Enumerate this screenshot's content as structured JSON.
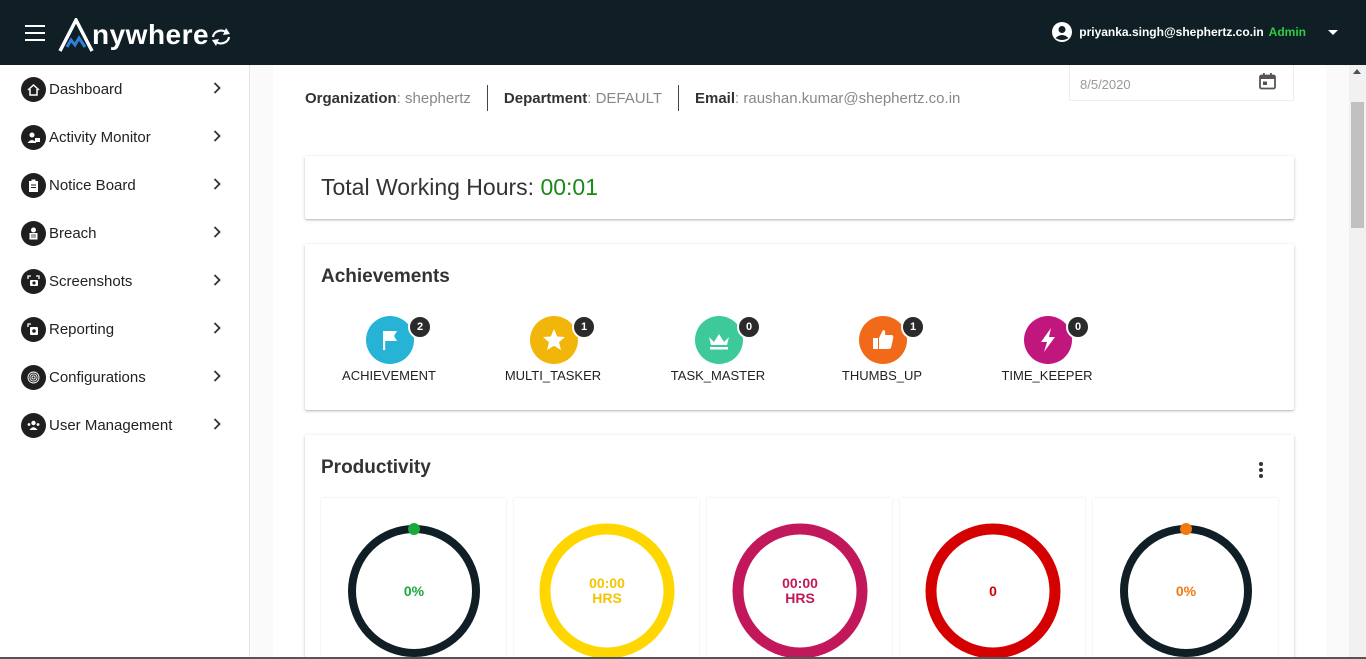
{
  "app": {
    "logo_text": "nywhere"
  },
  "user": {
    "email": "priyanka.singh@shephertz.co.in",
    "role": "Admin"
  },
  "sidebar": {
    "items": [
      {
        "label": "Dashboard",
        "icon": "home-icon"
      },
      {
        "label": "Activity Monitor",
        "icon": "person-monitor-icon"
      },
      {
        "label": "Notice Board",
        "icon": "clipboard-icon"
      },
      {
        "label": "Breach",
        "icon": "breach-icon"
      },
      {
        "label": "Screenshots",
        "icon": "screenshot-icon"
      },
      {
        "label": "Reporting",
        "icon": "report-icon"
      },
      {
        "label": "Configurations",
        "icon": "fingerprint-icon"
      },
      {
        "label": "User Management",
        "icon": "users-icon"
      }
    ]
  },
  "info": {
    "org_label": "Organization",
    "org_value": ": shephertz",
    "dept_label": "Department",
    "dept_value": ": DEFAULT",
    "email_label": "Email",
    "email_value": ": raushan.kumar@shephertz.co.in"
  },
  "date_picker": {
    "value": "8/5/2020"
  },
  "hours": {
    "label": "Total Working Hours: ",
    "value": "00:01"
  },
  "achievements": {
    "title": "Achievements",
    "badges": [
      {
        "label": "ACHIEVEMENT",
        "count": "2",
        "color": "#27b3d6",
        "icon": "flag-icon"
      },
      {
        "label": "MULTI_TASKER",
        "count": "1",
        "color": "#f2b50a",
        "icon": "star-icon"
      },
      {
        "label": "TASK_MASTER",
        "count": "0",
        "color": "#3dc99a",
        "icon": "crown-icon"
      },
      {
        "label": "THUMBS_UP",
        "count": "1",
        "color": "#f06a1a",
        "icon": "thumbs-up-icon"
      },
      {
        "label": "TIME_KEEPER",
        "count": "0",
        "color": "#c0167d",
        "icon": "lightning-icon"
      }
    ]
  },
  "productivity": {
    "title": "Productivity",
    "tiles": [
      {
        "line1": "0%",
        "line2": "",
        "ring_color": "#0f1f25",
        "text_color": "#1aaa3c",
        "dot_color": "#1aaa3c"
      },
      {
        "line1": "00:00",
        "line2": "HRS",
        "ring_color": "#ffd600",
        "text_color": "#f5c400",
        "dot_color": ""
      },
      {
        "line1": "00:00",
        "line2": "HRS",
        "ring_color": "#c2185b",
        "text_color": "#c2185b",
        "dot_color": ""
      },
      {
        "line1": "0",
        "line2": "",
        "ring_color": "#d50000",
        "text_color": "#d50000",
        "dot_color": ""
      },
      {
        "line1": "0%",
        "line2": "",
        "ring_color": "#0f1f25",
        "text_color": "#f07a10",
        "dot_color": "#f07a10"
      }
    ]
  }
}
